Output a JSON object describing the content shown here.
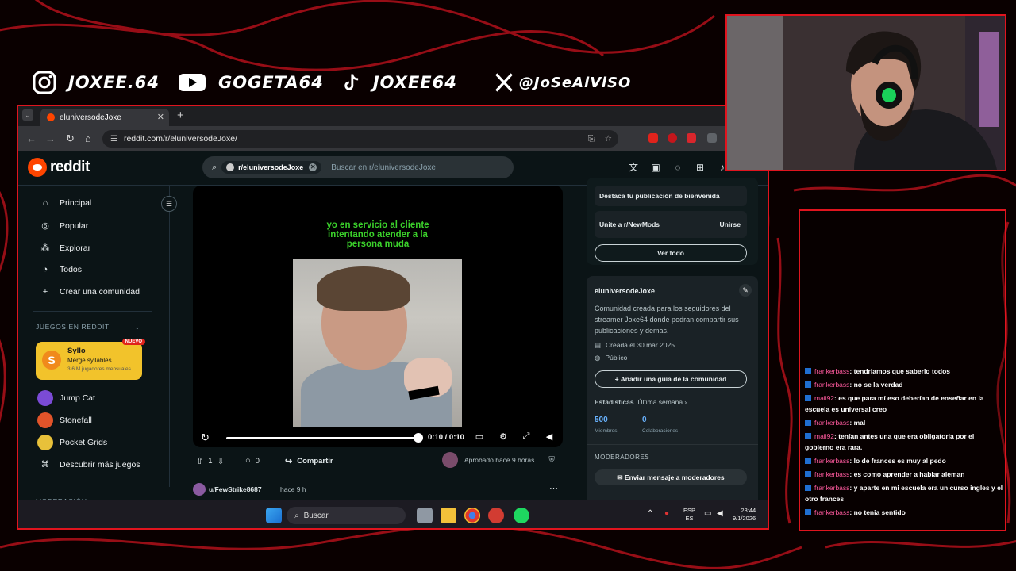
{
  "social": [
    {
      "icon": "instagram-icon",
      "handle": "JOXEE.64"
    },
    {
      "icon": "youtube-icon",
      "handle": "GOGETA64"
    },
    {
      "icon": "tiktok-icon",
      "handle": "JOXEE64"
    },
    {
      "icon": "x-icon",
      "handle": "@JoSeAlViSO"
    }
  ],
  "browser": {
    "tab_title": "eluniversodeJoxe",
    "url": "reddit.com/r/eluniversodeJoxe/"
  },
  "reddit": {
    "logo_text": "reddit",
    "search_chip": "r/eluniversodeJoxe",
    "search_placeholder": "Buscar en r/eluniversodeJoxe",
    "nav": [
      {
        "icon": "home-icon",
        "label": "Principal"
      },
      {
        "icon": "popular-icon",
        "label": "Popular"
      },
      {
        "icon": "explore-icon",
        "label": "Explorar"
      },
      {
        "icon": "all-icon",
        "label": "Todos"
      },
      {
        "icon": "plus-icon",
        "label": "Crear una comunidad"
      }
    ],
    "games_section": "JUEGOS EN REDDIT",
    "featured_game": {
      "title": "Syllo",
      "subtitle": "Merge syllables",
      "players": "3.6 M jugadores mensuales",
      "badge": "NUEVO"
    },
    "games": [
      {
        "label": "Jump Cat",
        "color": "#7b4bd6"
      },
      {
        "label": "Stonefall",
        "color": "#e2542a"
      },
      {
        "label": "Pocket Grids",
        "color": "#e8c13a"
      }
    ],
    "discover_games": "Descubrir más juegos",
    "moderation_section": "MODERACIÓN"
  },
  "post": {
    "caption_lines": [
      "yo en servicio al cliente",
      "intentando atender a la",
      "persona muda"
    ],
    "video_time": "0:10 / 0:10",
    "progress": 1.0,
    "votes": "1",
    "comments": "0",
    "share_label": "Compartir",
    "approved_label": "Aprobado hace 9 horas",
    "comment_user": "u/FewStrike8687",
    "comment_time": "hace 9 h"
  },
  "right": {
    "welcome": "Destaca tu publicación de bienvenida",
    "join_text": "Unite a r/NewMods",
    "join_button": "Unirse",
    "see_all": "Ver todo",
    "community_name": "eluniversodeJoxe",
    "description": "Comunidad creada para los seguidores del streamer Joxe64 donde podran compartir sus publicaciones y demas.",
    "created": "Creada el 30 mar 2025",
    "visibility": "Público",
    "guide_button": "Añadir una guía de la comunidad",
    "stats_label": "Estadísticas",
    "stats_period": "Última semana",
    "members_value": "500",
    "members_label": "Miembros",
    "collab_value": "0",
    "collab_label": "Colaboraciones",
    "moderators_heading": "MODERADORES",
    "message_mods": "Enviar mensaje a moderadores"
  },
  "taskbar": {
    "search_label": "Buscar",
    "lang_top": "ESP",
    "lang_bottom": "ES",
    "time": "23:44",
    "date": "9/1/2026"
  },
  "chat": [
    {
      "user": "frankerbass",
      "text": ": tendriamos que saberlo todos"
    },
    {
      "user": "frankerbass",
      "text": ": no se la verdad"
    },
    {
      "user": "maii92",
      "text": ": es que para mí eso deberían de enseñar en la escuela es universal creo"
    },
    {
      "user": "frankerbass",
      "text": ": mal"
    },
    {
      "user": "maii92",
      "text": ": tenían antes una que era obligatoria por el gobierno era rara."
    },
    {
      "user": "frankerbass",
      "text": ": lo de frances es muy al pedo"
    },
    {
      "user": "frankerbass",
      "text": ": es como aprender a hablar aleman"
    },
    {
      "user": "frankerbass",
      "text": ": y aparte en mi escuela era un curso ingles y el otro frances"
    },
    {
      "user": "frankerbass",
      "text": ": no tenia sentido"
    }
  ]
}
